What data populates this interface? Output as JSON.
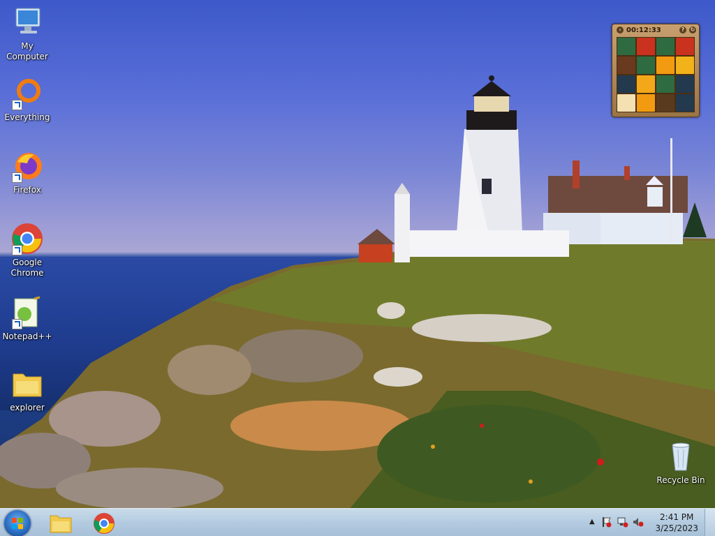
{
  "desktop_icons": [
    {
      "label": "My Computer"
    },
    {
      "label": "Everything"
    },
    {
      "label": "Firefox"
    },
    {
      "label": "Google Chrome"
    },
    {
      "label": "Notepad++"
    },
    {
      "label": "explorer"
    },
    {
      "label": "Recycle Bin"
    }
  ],
  "gadget": {
    "timer": "00:12:33",
    "tiles": [
      "#2e6b40",
      "#c8321e",
      "#2e6b40",
      "#c8321e",
      "#6a3a1e",
      "#2e6b40",
      "#f29a10",
      "#f2b21a",
      "#22394e",
      "#f2a818",
      "#2e6b40",
      "#22394e",
      "#f4e0b0",
      "#f29a10",
      "#5a3a1e",
      "#22394e"
    ]
  },
  "taskbar": {
    "time": "2:41 PM",
    "date": "3/25/2023"
  },
  "colors": {
    "taskbar": "#b3cbe0",
    "accent": "#2a6fc4"
  }
}
